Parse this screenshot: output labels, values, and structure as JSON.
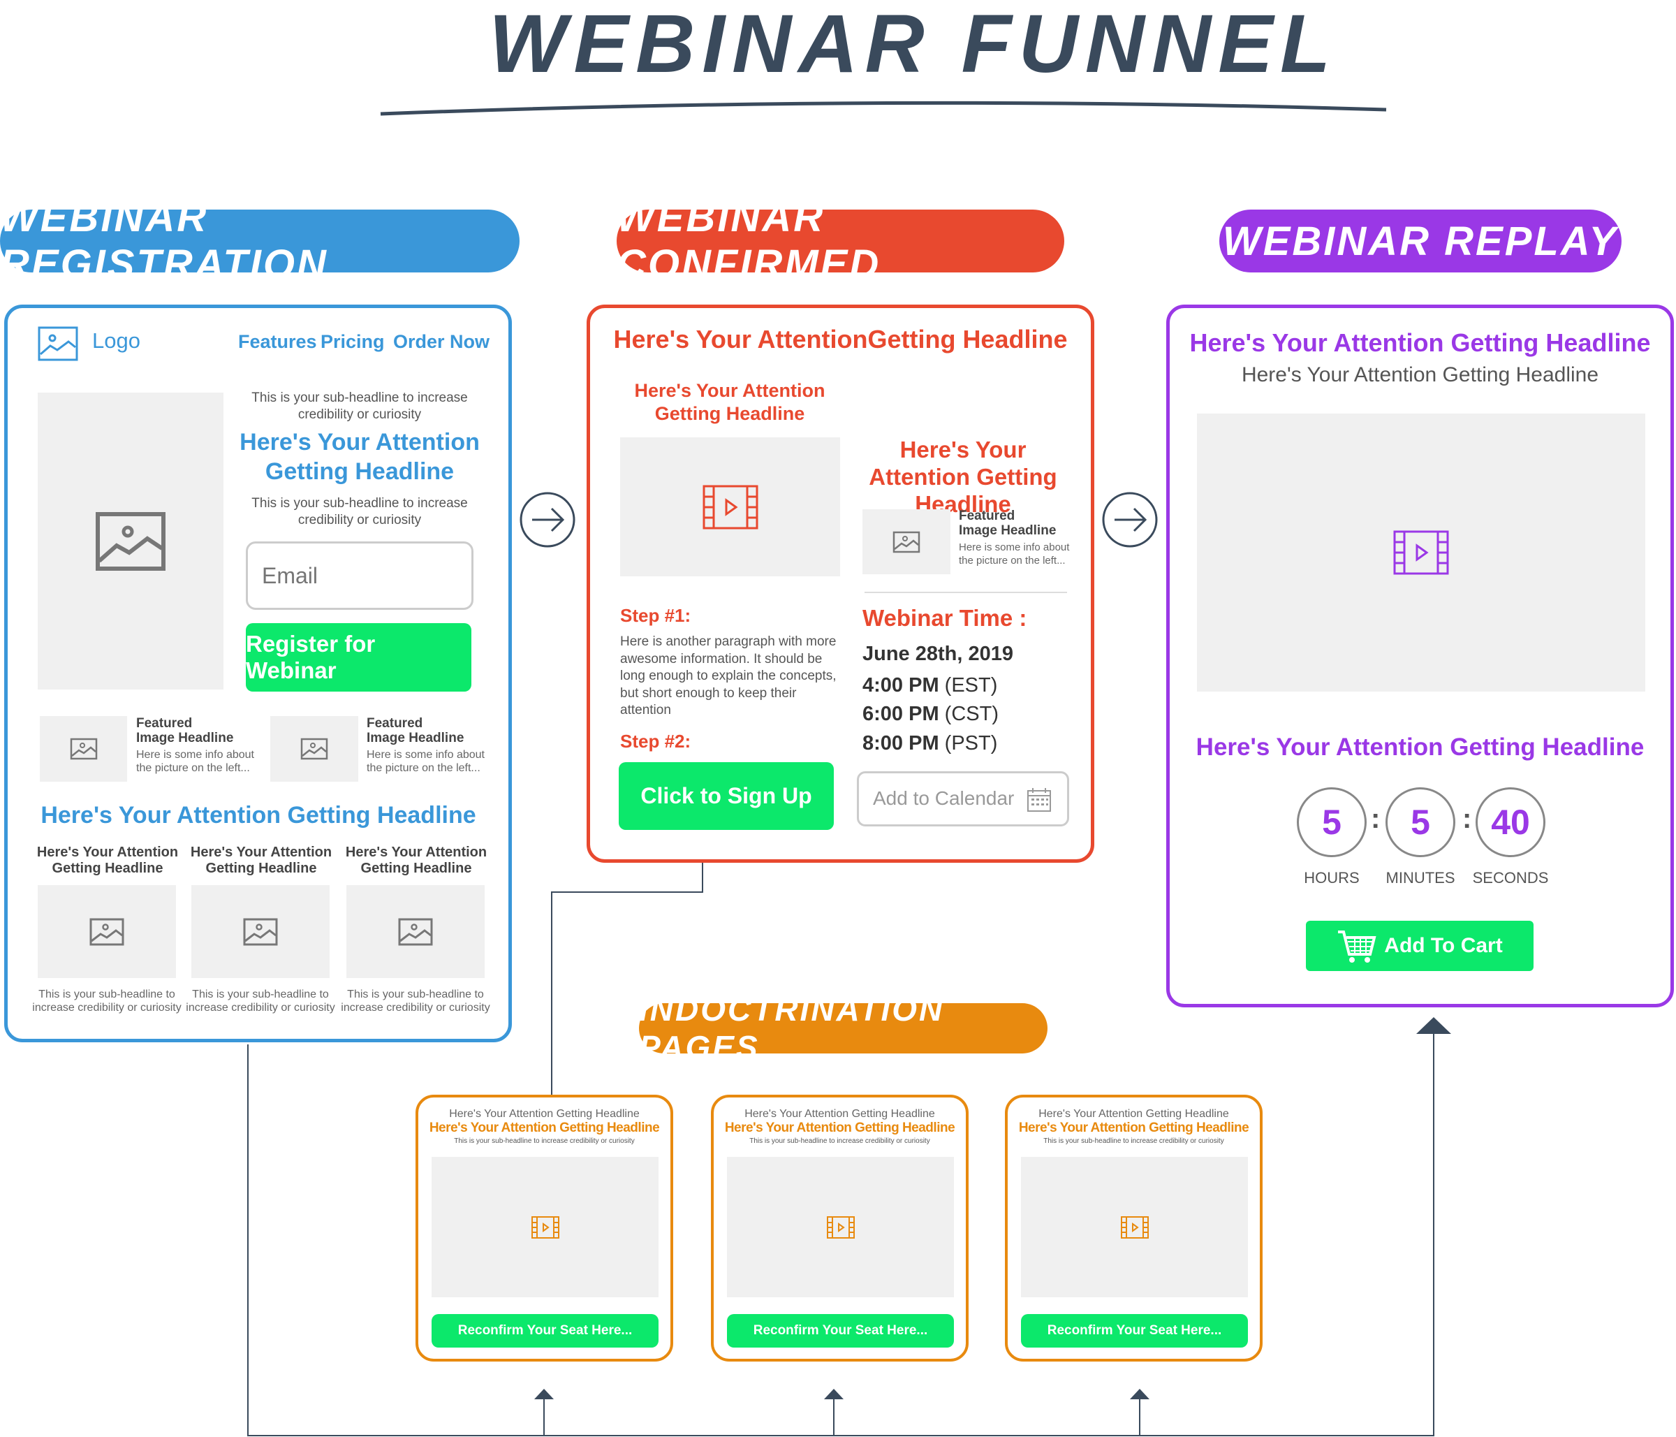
{
  "title": "WEBINAR FUNNEL",
  "colors": {
    "registration": "#3a97d9",
    "confirmed": "#e8492f",
    "replay": "#9a38e6",
    "indoctrination": "#e88a0f",
    "button": "#0ce86b",
    "connector": "#3a4a5c"
  },
  "badges": {
    "registration": "WEBINAR REGISTRATION",
    "confirmed": "WEBINAR CONFIRMED",
    "replay": "WEBINAR REPLAY",
    "indoctrination": "INDOCTRINATION PAGES"
  },
  "registration": {
    "logo": "Logo",
    "nav": [
      "Features",
      "Pricing",
      "Order Now"
    ],
    "subheadline1": "This is your sub-headline to increase credibility or curiosity",
    "headline": "Here's Your Attention Getting Headline",
    "subheadline2": "This is your sub-headline to increase credibility or curiosity",
    "email_placeholder": "Email",
    "register_button": "Register for Webinar",
    "featured": [
      {
        "title": "Featured Image Headline",
        "info": "Here is some info about the picture on the left..."
      },
      {
        "title": "Featured Image Headline",
        "info": "Here is some info about the picture on the left..."
      }
    ],
    "headline2": "Here's Your Attention Getting Headline",
    "columns": [
      {
        "title": "Here's Your Attention Getting Headline",
        "caption": "This is your sub-headline to increase credibility or curiosity"
      },
      {
        "title": "Here's Your Attention Getting Headline",
        "caption": "This is your sub-headline to increase credibility or curiosity"
      },
      {
        "title": "Here's Your Attention Getting Headline",
        "caption": "This is your sub-headline to increase credibility or curiosity"
      }
    ]
  },
  "confirmed": {
    "headline": "Here's Your AttentionGetting Headline",
    "subheadline": "Here's Your Attention Getting Headline",
    "right_headline": "Here's Your Attention Getting Headline",
    "featured": {
      "title": "Featured Image Headline",
      "info": "Here is some info about the picture on the left..."
    },
    "step1": "Step #1:",
    "paragraph": "Here is another paragraph with more awesome information. It should be long enough to explain the concepts, but short enough to keep their attention",
    "step2": "Step #2:",
    "signup_button": "Click to Sign Up",
    "webinar_time_label": "Webinar Time :",
    "date": "June 28th, 2019",
    "times": [
      {
        "time": "4:00 PM",
        "zone": "(EST)"
      },
      {
        "time": "6:00 PM",
        "zone": "(CST)"
      },
      {
        "time": "8:00 PM",
        "zone": "(PST)"
      }
    ],
    "calendar_button": "Add to Calendar"
  },
  "replay": {
    "headline": "Here's Your Attention Getting Headline",
    "subheadline": "Here's Your Attention Getting Headline",
    "headline2": "Here's Your Attention Getting Headline",
    "countdown": [
      {
        "value": "5",
        "label": "HOURS"
      },
      {
        "value": "5",
        "label": "MINUTES"
      },
      {
        "value": "40",
        "label": "SECONDS"
      }
    ],
    "separator": ":",
    "cart_button": "Add To Cart"
  },
  "indoctrination": [
    {
      "top": "Here's Your Attention Getting Headline",
      "headline": "Here's Your Attention Getting Headline",
      "sub": "This is your sub-headline to increase credibility or curiosity",
      "button": "Reconfirm Your Seat Here..."
    },
    {
      "top": "Here's Your Attention Getting Headline",
      "headline": "Here's Your Attention Getting Headline",
      "sub": "This is your sub-headline to increase credibility or curiosity",
      "button": "Reconfirm Your Seat Here..."
    },
    {
      "top": "Here's Your Attention Getting Headline",
      "headline": "Here's Your Attention Getting Headline",
      "sub": "This is your sub-headline to increase credibility or curiosity",
      "button": "Reconfirm Your Seat Here..."
    }
  ]
}
